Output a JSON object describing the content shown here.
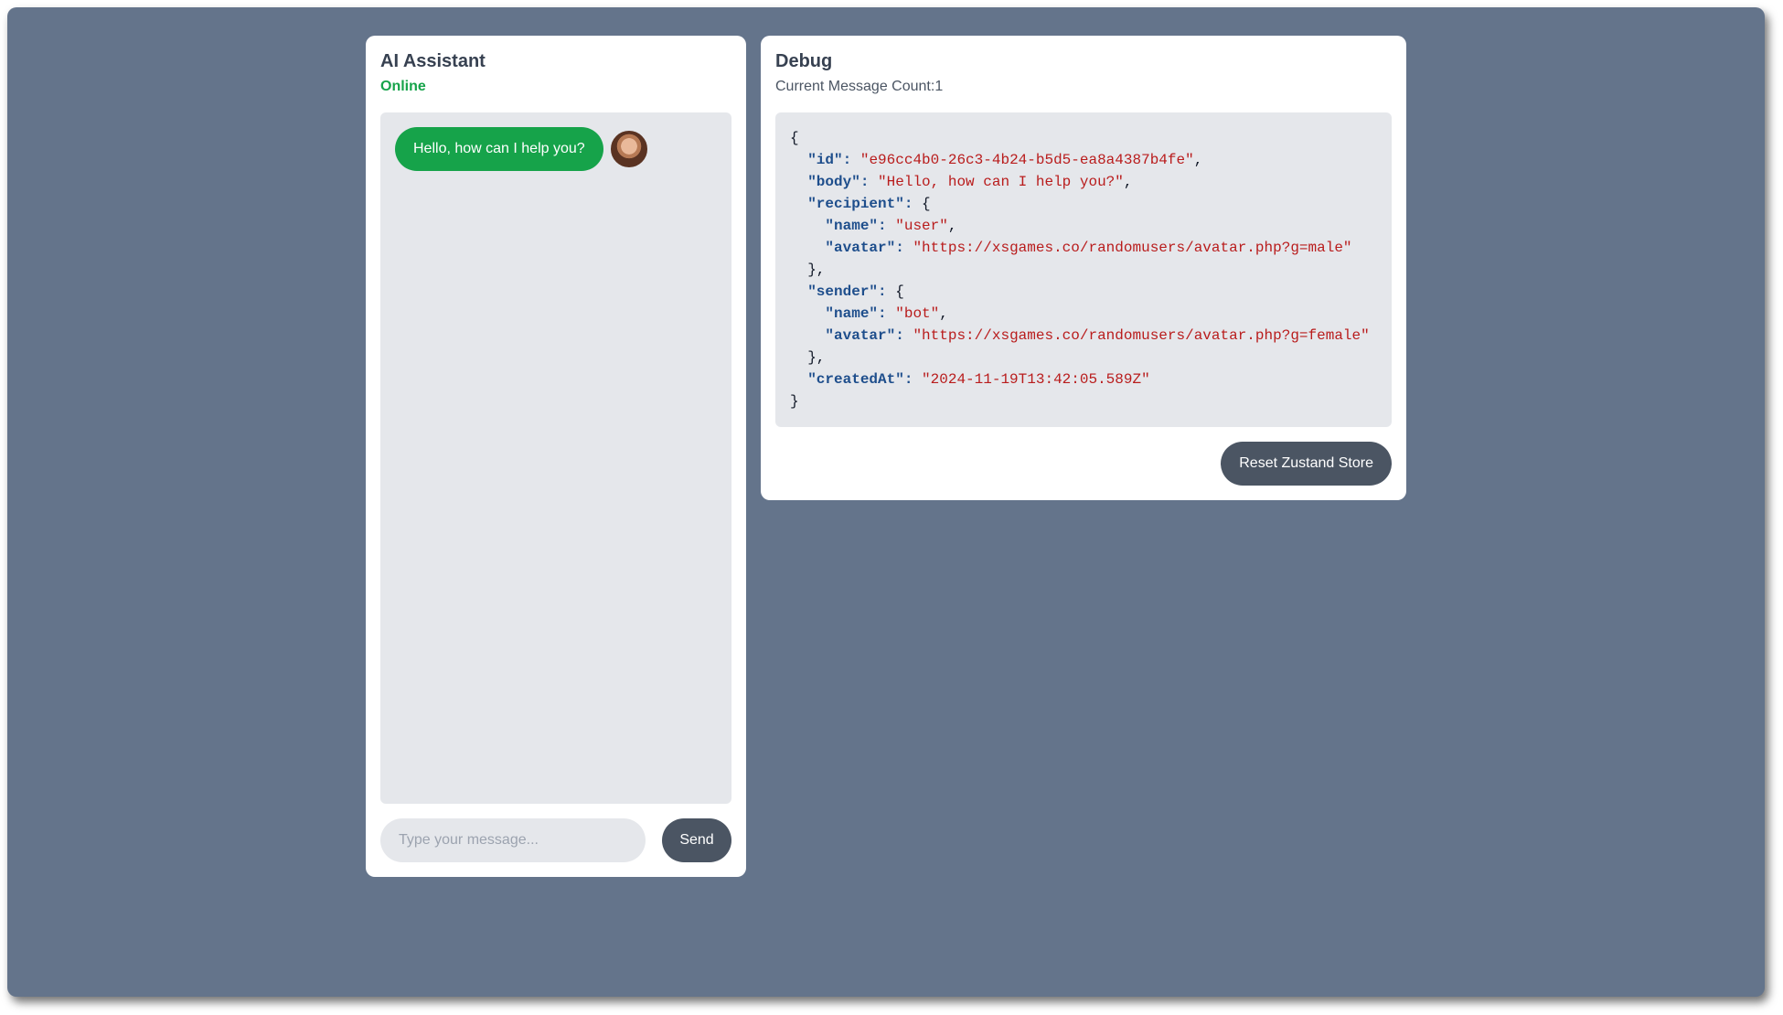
{
  "chat": {
    "title": "AI Assistant",
    "status": "Online",
    "messages": [
      {
        "body": "Hello, how can I help you?",
        "sender": "bot"
      }
    ],
    "input_placeholder": "Type your message...",
    "send_label": "Send"
  },
  "debug": {
    "title": "Debug",
    "count_label": "Current Message Count:",
    "count": "1",
    "json": {
      "id": "e96cc4b0-26c3-4b24-b5d5-ea8a4387b4fe",
      "body": "Hello, how can I help you?",
      "recipient_name": "user",
      "recipient_avatar": "https://xsgames.co/randomusers/avatar.php?g=male",
      "sender_name": "bot",
      "sender_avatar": "https://xsgames.co/randomusers/avatar.php?g=female",
      "createdAt": "2024-11-19T13:42:05.589Z"
    },
    "reset_label": "Reset Zustand Store"
  },
  "colors": {
    "background": "#64748b",
    "accent_green": "#16a34a",
    "button_dark": "#4b5563",
    "json_key": "#1e4e8c",
    "json_string": "#b91c1c"
  }
}
